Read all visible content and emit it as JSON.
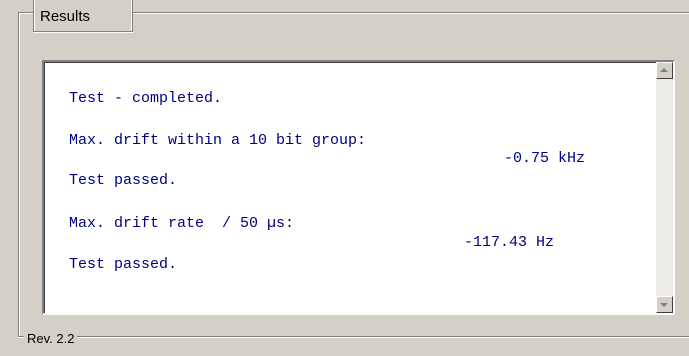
{
  "group": {
    "title": "Results"
  },
  "results_text": {
    "line1": "Test - completed.",
    "line2": "Max. drift within a 10 bit group:",
    "value1": "-0.75 kHz",
    "line3": "Test passed.",
    "line4": "Max. drift rate  / 50 µs:",
    "value2": "-117.43 Hz",
    "line5": "Test passed."
  },
  "scrollbar": {
    "up_icon": "arrow-up-icon",
    "down_icon": "arrow-down-icon"
  },
  "footer": {
    "revision": "Rev. 2.2"
  }
}
